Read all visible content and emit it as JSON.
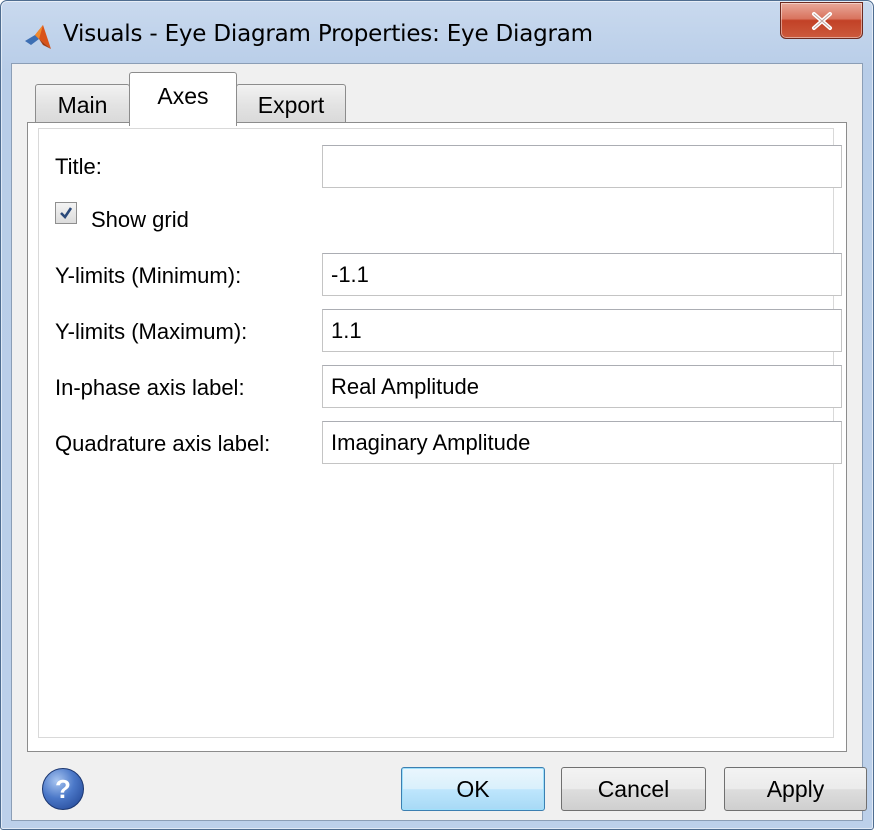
{
  "window": {
    "title": "Visuals - Eye Diagram Properties: Eye Diagram",
    "close_glyph": "X"
  },
  "tabs": [
    {
      "label": "Main",
      "active": false
    },
    {
      "label": "Axes",
      "active": true
    },
    {
      "label": "Export",
      "active": false
    }
  ],
  "form": {
    "title_label": "Title:",
    "title_value": "",
    "show_grid_label": "Show grid",
    "show_grid_checked": true,
    "ymin_label": "Y-limits (Minimum):",
    "ymin_value": "-1.1",
    "ymax_label": "Y-limits (Maximum):",
    "ymax_value": "1.1",
    "inphase_label": "In-phase axis label:",
    "inphase_value": "Real Amplitude",
    "quad_label": "Quadrature axis label:",
    "quad_value": "Imaginary Amplitude"
  },
  "footer": {
    "help_glyph": "?",
    "ok_label": "OK",
    "cancel_label": "Cancel",
    "apply_label": "Apply"
  },
  "colors": {
    "close_red": "#c24126",
    "default_button_border": "#3c7fb1",
    "matlab_logo": "#d95319"
  },
  "icons": [
    "matlab-logo-icon",
    "close-icon",
    "checkmark-icon",
    "help-icon"
  ]
}
